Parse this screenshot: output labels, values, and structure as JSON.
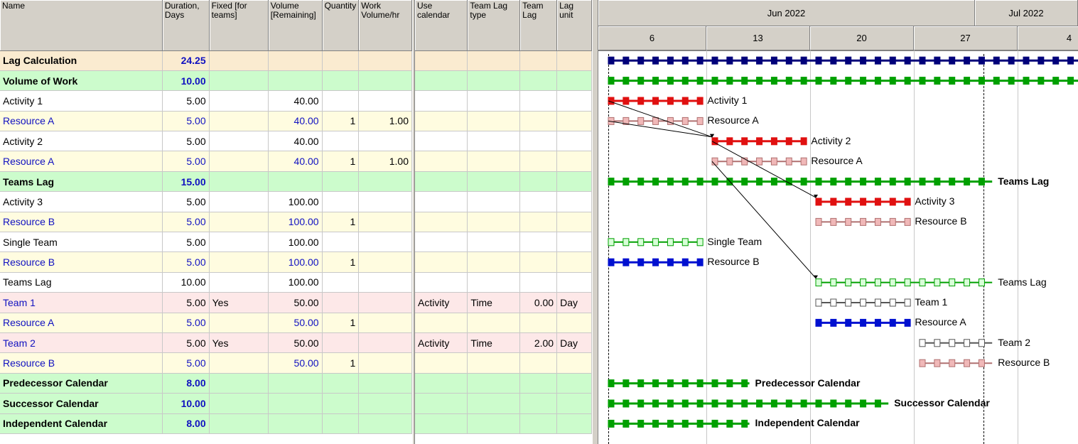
{
  "left_columns": [
    {
      "label": "Name",
      "w": 230
    },
    {
      "label": "Duration, Days",
      "w": 66
    },
    {
      "label": "Fixed [for teams]",
      "w": 84
    },
    {
      "label": "Volume [Remaining]",
      "w": 76
    },
    {
      "label": "Quantity",
      "w": 49
    },
    {
      "label": "Work Volume/hr",
      "w": 75
    }
  ],
  "mid_columns": [
    {
      "label": "Use calendar",
      "w": 74
    },
    {
      "label": "Team Lag type",
      "w": 74
    },
    {
      "label": "Team Lag",
      "w": 52
    },
    {
      "label": "Lag unit",
      "w": 49
    }
  ],
  "rows": [
    {
      "type": "summary",
      "indent": "ind0",
      "name": "Lag Calculation",
      "duration": "24.25",
      "fixed": "",
      "volume": "",
      "quantity": "",
      "work": "",
      "calendar": "",
      "lagtype": "",
      "lag": "",
      "unit": ""
    },
    {
      "type": "group",
      "indent": "ind1",
      "name": "Volume of Work",
      "duration": "10.00",
      "fixed": "",
      "volume": "",
      "quantity": "",
      "work": "",
      "calendar": "",
      "lagtype": "",
      "lag": "",
      "unit": ""
    },
    {
      "type": "activity",
      "indent": "ind2",
      "name": "Activity 1",
      "duration": "5.00",
      "fixed": "",
      "volume": "40.00",
      "quantity": "",
      "work": "",
      "calendar": "",
      "lagtype": "",
      "lag": "",
      "unit": ""
    },
    {
      "type": "resource",
      "indent": "ind-res2",
      "name": "Resource A",
      "duration": "5.00",
      "fixed": "",
      "volume": "40.00",
      "quantity": "1",
      "work": "1.00",
      "calendar": "",
      "lagtype": "",
      "lag": "",
      "unit": ""
    },
    {
      "type": "activity",
      "indent": "ind2",
      "name": "Activity 2",
      "duration": "5.00",
      "fixed": "",
      "volume": "40.00",
      "quantity": "",
      "work": "",
      "calendar": "",
      "lagtype": "",
      "lag": "",
      "unit": ""
    },
    {
      "type": "resource",
      "indent": "ind-res2",
      "name": "Resource A",
      "duration": "5.00",
      "fixed": "",
      "volume": "40.00",
      "quantity": "1",
      "work": "1.00",
      "calendar": "",
      "lagtype": "",
      "lag": "",
      "unit": ""
    },
    {
      "type": "group",
      "indent": "ind1",
      "name": "Teams Lag",
      "duration": "15.00",
      "fixed": "",
      "volume": "",
      "quantity": "",
      "work": "",
      "calendar": "",
      "lagtype": "",
      "lag": "",
      "unit": ""
    },
    {
      "type": "activity",
      "indent": "ind2",
      "name": "Activity 3",
      "duration": "5.00",
      "fixed": "",
      "volume": "100.00",
      "quantity": "",
      "work": "",
      "calendar": "",
      "lagtype": "",
      "lag": "",
      "unit": ""
    },
    {
      "type": "resource",
      "indent": "ind-res2",
      "name": "Resource B",
      "duration": "5.00",
      "fixed": "",
      "volume": "100.00",
      "quantity": "1",
      "work": "",
      "calendar": "",
      "lagtype": "",
      "lag": "",
      "unit": ""
    },
    {
      "type": "activity",
      "indent": "ind2",
      "name": "Single Team",
      "duration": "5.00",
      "fixed": "",
      "volume": "100.00",
      "quantity": "",
      "work": "",
      "calendar": "",
      "lagtype": "",
      "lag": "",
      "unit": ""
    },
    {
      "type": "resource",
      "indent": "ind-res2",
      "name": "Resource B",
      "duration": "5.00",
      "fixed": "",
      "volume": "100.00",
      "quantity": "1",
      "work": "",
      "calendar": "",
      "lagtype": "",
      "lag": "",
      "unit": ""
    },
    {
      "type": "activity",
      "indent": "ind2",
      "name": "Teams Lag",
      "duration": "10.00",
      "fixed": "",
      "volume": "100.00",
      "quantity": "",
      "work": "",
      "calendar": "",
      "lagtype": "",
      "lag": "",
      "unit": ""
    },
    {
      "type": "team",
      "indent": "ind-team",
      "name": "Team 1",
      "duration": "5.00",
      "fixed": "Yes",
      "volume": "50.00",
      "quantity": "",
      "work": "",
      "calendar": "Activity",
      "lagtype": "Time",
      "lag": "0.00",
      "unit": "Day"
    },
    {
      "type": "resource",
      "indent": "ind-res2",
      "name": "Resource A",
      "duration": "5.00",
      "fixed": "",
      "volume": "50.00",
      "quantity": "1",
      "work": "",
      "calendar": "",
      "lagtype": "",
      "lag": "",
      "unit": ""
    },
    {
      "type": "team",
      "indent": "ind-team",
      "name": "Team 2",
      "duration": "5.00",
      "fixed": "Yes",
      "volume": "50.00",
      "quantity": "",
      "work": "",
      "calendar": "Activity",
      "lagtype": "Time",
      "lag": "2.00",
      "unit": "Day"
    },
    {
      "type": "resource",
      "indent": "ind-res2",
      "name": "Resource B",
      "duration": "5.00",
      "fixed": "",
      "volume": "50.00",
      "quantity": "1",
      "work": "",
      "calendar": "",
      "lagtype": "",
      "lag": "",
      "unit": ""
    },
    {
      "type": "group",
      "indent": "ind1",
      "name": "Predecessor Calendar",
      "duration": "8.00",
      "fixed": "",
      "volume": "",
      "quantity": "",
      "work": "",
      "calendar": "",
      "lagtype": "",
      "lag": "",
      "unit": ""
    },
    {
      "type": "group",
      "indent": "ind1",
      "name": "Successor Calendar",
      "duration": "10.00",
      "fixed": "",
      "volume": "",
      "quantity": "",
      "work": "",
      "calendar": "",
      "lagtype": "",
      "lag": "",
      "unit": ""
    },
    {
      "type": "group",
      "indent": "ind1",
      "name": "Independent Calendar",
      "duration": "8.00",
      "fixed": "",
      "volume": "",
      "quantity": "",
      "work": "",
      "calendar": "",
      "lagtype": "",
      "lag": "",
      "unit": ""
    }
  ],
  "gantt": {
    "months": [
      {
        "label": "Jun 2022"
      },
      {
        "label": "Jul 2022"
      }
    ],
    "weeks": [
      {
        "label": "6"
      },
      {
        "label": "13"
      },
      {
        "label": "20"
      },
      {
        "label": "27"
      },
      {
        "label": "4"
      }
    ],
    "bars": [
      {
        "label": "Lag Calculation",
        "bold": true,
        "style": "summary",
        "segments": [
          [
            0,
            9.4
          ]
        ]
      },
      {
        "label": "Volume of Work",
        "bold": true,
        "style": "group",
        "segments": [
          [
            0,
            5
          ]
        ]
      },
      {
        "label": "Activity 1",
        "bold": false,
        "style": "activity",
        "segments": [
          [
            0,
            0.9
          ]
        ]
      },
      {
        "label": "Resource A",
        "bold": false,
        "style": "resource",
        "segments": [
          [
            0,
            0.9
          ]
        ]
      },
      {
        "label": "Activity 2",
        "bold": false,
        "style": "activity",
        "segments": [
          [
            1,
            1.9
          ]
        ]
      },
      {
        "label": "Resource A",
        "bold": false,
        "style": "resource",
        "segments": [
          [
            1,
            1.9
          ]
        ]
      },
      {
        "label": "Teams Lag",
        "bold": true,
        "style": "group",
        "segments": [
          [
            0,
            3.7
          ]
        ]
      },
      {
        "label": "Activity 3",
        "bold": false,
        "style": "activity",
        "segments": [
          [
            2,
            2.9
          ]
        ]
      },
      {
        "label": "Resource B",
        "bold": false,
        "style": "resource",
        "segments": [
          [
            2,
            2.9
          ]
        ]
      },
      {
        "label": "Single Team",
        "bold": false,
        "style": "team",
        "segments": [
          [
            0,
            0.9
          ]
        ]
      },
      {
        "label": "Resource B",
        "bold": false,
        "style": "resbar",
        "segments": [
          [
            0,
            0.9
          ]
        ]
      },
      {
        "label": "Teams Lag",
        "bold": false,
        "style": "team",
        "segments": [
          [
            2,
            3.7
          ]
        ]
      },
      {
        "label": "Team 1",
        "bold": false,
        "style": "teamw",
        "segments": [
          [
            2,
            2.9
          ]
        ]
      },
      {
        "label": "Resource A",
        "bold": false,
        "style": "resbar",
        "segments": [
          [
            2,
            2.9
          ]
        ]
      },
      {
        "label": "Team 2",
        "bold": false,
        "style": "teamw",
        "segments": [
          [
            3,
            3.7
          ]
        ]
      },
      {
        "label": "Resource B",
        "bold": false,
        "style": "resource",
        "segments": [
          [
            3,
            3.7
          ]
        ]
      },
      {
        "label": "Predecessor Calendar",
        "bold": true,
        "style": "group",
        "segments": [
          [
            0,
            1.36
          ]
        ]
      },
      {
        "label": "Successor Calendar",
        "bold": true,
        "style": "group",
        "segments": [
          [
            0,
            2.7
          ]
        ]
      },
      {
        "label": "Independent Calendar",
        "bold": true,
        "style": "group",
        "segments": [
          [
            0,
            1.36
          ]
        ]
      }
    ],
    "links": [
      [
        2,
        4
      ],
      [
        3,
        4
      ],
      [
        4,
        7
      ],
      [
        5,
        11
      ]
    ]
  },
  "colors": {
    "summary_bar": "#00007a",
    "group_bar": "#00a000",
    "activity_bar": "#e01010",
    "resource_bar": "#f0b8b8",
    "team_bar": "#00a000",
    "resbar_blue": "#0010d0"
  }
}
